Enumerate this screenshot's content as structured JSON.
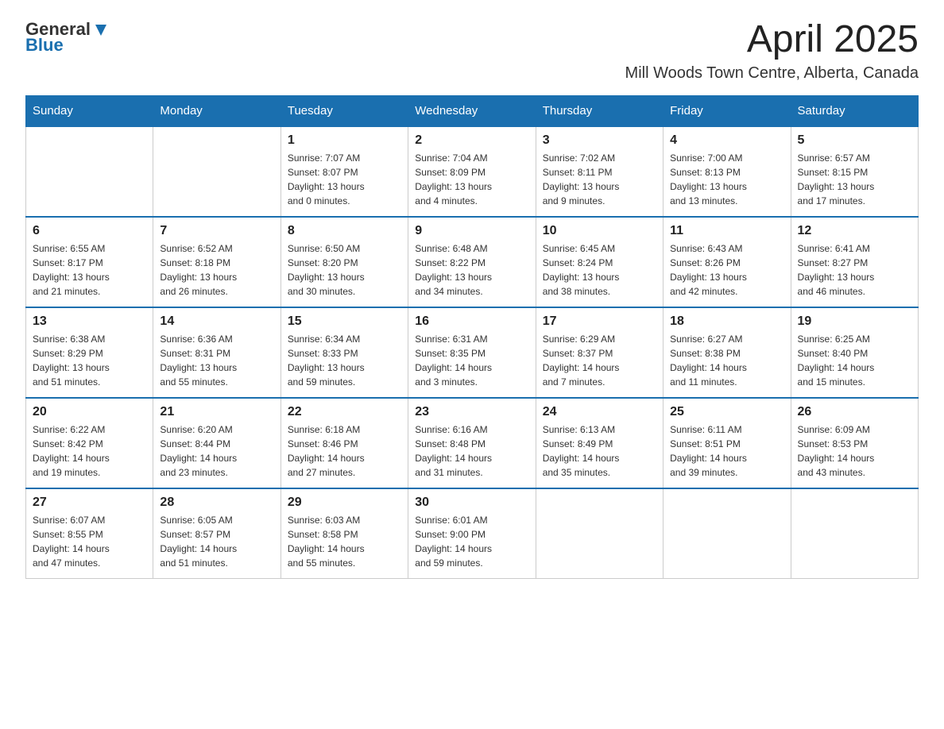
{
  "header": {
    "logo_general": "General",
    "logo_blue": "Blue",
    "month": "April 2025",
    "location": "Mill Woods Town Centre, Alberta, Canada"
  },
  "weekdays": [
    "Sunday",
    "Monday",
    "Tuesday",
    "Wednesday",
    "Thursday",
    "Friday",
    "Saturday"
  ],
  "weeks": [
    [
      {
        "day": "",
        "info": ""
      },
      {
        "day": "",
        "info": ""
      },
      {
        "day": "1",
        "info": "Sunrise: 7:07 AM\nSunset: 8:07 PM\nDaylight: 13 hours\nand 0 minutes."
      },
      {
        "day": "2",
        "info": "Sunrise: 7:04 AM\nSunset: 8:09 PM\nDaylight: 13 hours\nand 4 minutes."
      },
      {
        "day": "3",
        "info": "Sunrise: 7:02 AM\nSunset: 8:11 PM\nDaylight: 13 hours\nand 9 minutes."
      },
      {
        "day": "4",
        "info": "Sunrise: 7:00 AM\nSunset: 8:13 PM\nDaylight: 13 hours\nand 13 minutes."
      },
      {
        "day": "5",
        "info": "Sunrise: 6:57 AM\nSunset: 8:15 PM\nDaylight: 13 hours\nand 17 minutes."
      }
    ],
    [
      {
        "day": "6",
        "info": "Sunrise: 6:55 AM\nSunset: 8:17 PM\nDaylight: 13 hours\nand 21 minutes."
      },
      {
        "day": "7",
        "info": "Sunrise: 6:52 AM\nSunset: 8:18 PM\nDaylight: 13 hours\nand 26 minutes."
      },
      {
        "day": "8",
        "info": "Sunrise: 6:50 AM\nSunset: 8:20 PM\nDaylight: 13 hours\nand 30 minutes."
      },
      {
        "day": "9",
        "info": "Sunrise: 6:48 AM\nSunset: 8:22 PM\nDaylight: 13 hours\nand 34 minutes."
      },
      {
        "day": "10",
        "info": "Sunrise: 6:45 AM\nSunset: 8:24 PM\nDaylight: 13 hours\nand 38 minutes."
      },
      {
        "day": "11",
        "info": "Sunrise: 6:43 AM\nSunset: 8:26 PM\nDaylight: 13 hours\nand 42 minutes."
      },
      {
        "day": "12",
        "info": "Sunrise: 6:41 AM\nSunset: 8:27 PM\nDaylight: 13 hours\nand 46 minutes."
      }
    ],
    [
      {
        "day": "13",
        "info": "Sunrise: 6:38 AM\nSunset: 8:29 PM\nDaylight: 13 hours\nand 51 minutes."
      },
      {
        "day": "14",
        "info": "Sunrise: 6:36 AM\nSunset: 8:31 PM\nDaylight: 13 hours\nand 55 minutes."
      },
      {
        "day": "15",
        "info": "Sunrise: 6:34 AM\nSunset: 8:33 PM\nDaylight: 13 hours\nand 59 minutes."
      },
      {
        "day": "16",
        "info": "Sunrise: 6:31 AM\nSunset: 8:35 PM\nDaylight: 14 hours\nand 3 minutes."
      },
      {
        "day": "17",
        "info": "Sunrise: 6:29 AM\nSunset: 8:37 PM\nDaylight: 14 hours\nand 7 minutes."
      },
      {
        "day": "18",
        "info": "Sunrise: 6:27 AM\nSunset: 8:38 PM\nDaylight: 14 hours\nand 11 minutes."
      },
      {
        "day": "19",
        "info": "Sunrise: 6:25 AM\nSunset: 8:40 PM\nDaylight: 14 hours\nand 15 minutes."
      }
    ],
    [
      {
        "day": "20",
        "info": "Sunrise: 6:22 AM\nSunset: 8:42 PM\nDaylight: 14 hours\nand 19 minutes."
      },
      {
        "day": "21",
        "info": "Sunrise: 6:20 AM\nSunset: 8:44 PM\nDaylight: 14 hours\nand 23 minutes."
      },
      {
        "day": "22",
        "info": "Sunrise: 6:18 AM\nSunset: 8:46 PM\nDaylight: 14 hours\nand 27 minutes."
      },
      {
        "day": "23",
        "info": "Sunrise: 6:16 AM\nSunset: 8:48 PM\nDaylight: 14 hours\nand 31 minutes."
      },
      {
        "day": "24",
        "info": "Sunrise: 6:13 AM\nSunset: 8:49 PM\nDaylight: 14 hours\nand 35 minutes."
      },
      {
        "day": "25",
        "info": "Sunrise: 6:11 AM\nSunset: 8:51 PM\nDaylight: 14 hours\nand 39 minutes."
      },
      {
        "day": "26",
        "info": "Sunrise: 6:09 AM\nSunset: 8:53 PM\nDaylight: 14 hours\nand 43 minutes."
      }
    ],
    [
      {
        "day": "27",
        "info": "Sunrise: 6:07 AM\nSunset: 8:55 PM\nDaylight: 14 hours\nand 47 minutes."
      },
      {
        "day": "28",
        "info": "Sunrise: 6:05 AM\nSunset: 8:57 PM\nDaylight: 14 hours\nand 51 minutes."
      },
      {
        "day": "29",
        "info": "Sunrise: 6:03 AM\nSunset: 8:58 PM\nDaylight: 14 hours\nand 55 minutes."
      },
      {
        "day": "30",
        "info": "Sunrise: 6:01 AM\nSunset: 9:00 PM\nDaylight: 14 hours\nand 59 minutes."
      },
      {
        "day": "",
        "info": ""
      },
      {
        "day": "",
        "info": ""
      },
      {
        "day": "",
        "info": ""
      }
    ]
  ]
}
